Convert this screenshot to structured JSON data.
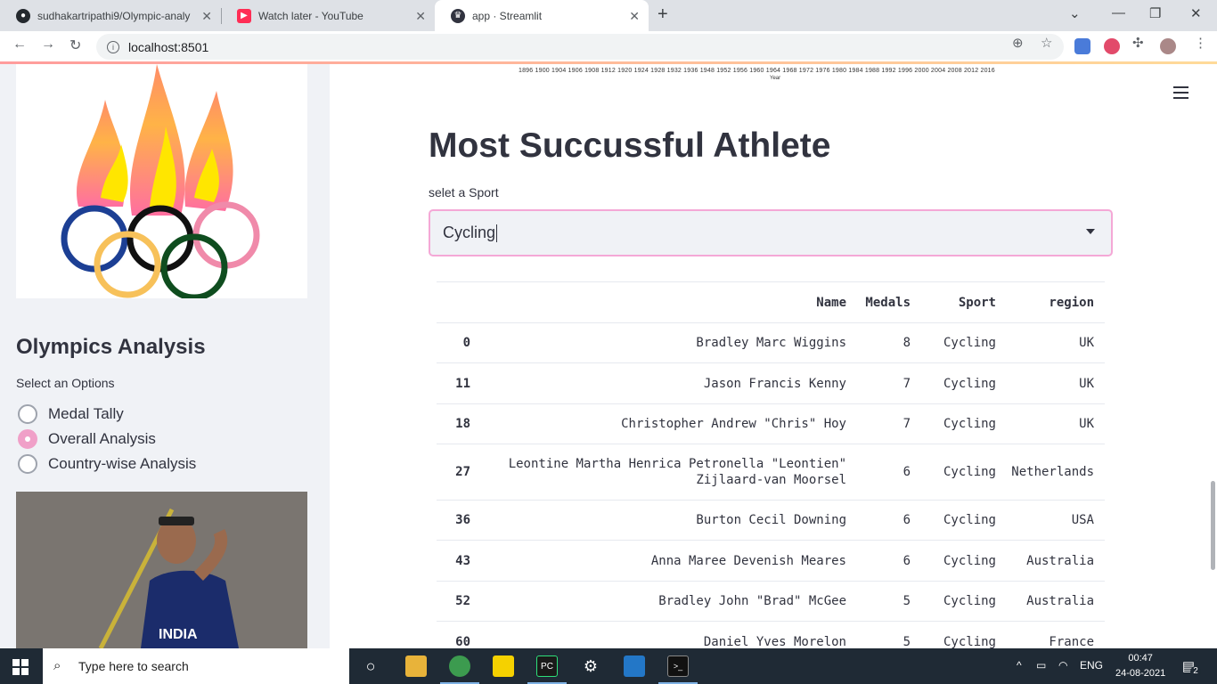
{
  "browser": {
    "tabs": [
      {
        "label": "sudhakartripathi9/Olympic-analy",
        "icon": "github-icon",
        "active": false
      },
      {
        "label": "Watch later - YouTube",
        "icon": "youtube-icon",
        "active": false
      },
      {
        "label": "app · Streamlit",
        "icon": "streamlit-icon",
        "active": true
      }
    ],
    "url": "localhost:8501"
  },
  "sidebar": {
    "title": "Olympics Analysis",
    "options_label": "Select an Options",
    "options": [
      {
        "label": "Medal Tally",
        "selected": false
      },
      {
        "label": "Overall Analysis",
        "selected": true
      },
      {
        "label": "Country-wise Analysis",
        "selected": false
      }
    ],
    "accent_color": "#f0a0c8"
  },
  "main": {
    "prev_chart_axis": {
      "ticks": "1896 1900 1904 1906 1908 1912 1920 1924 1928 1932 1936 1948 1952 1956 1960 1964 1968 1972 1976 1980 1984 1988 1992 1996 2000 2004 2008 2012 2016",
      "xlabel": "Year"
    },
    "heading": "Most Succussful Athlete",
    "select_label": "selet a Sport",
    "select_value": "Cycling",
    "table": {
      "columns": [
        "",
        "Name",
        "Medals",
        "Sport",
        "region"
      ],
      "rows": [
        [
          "0",
          "Bradley Marc Wiggins",
          "8",
          "Cycling",
          "UK"
        ],
        [
          "11",
          "Jason Francis Kenny",
          "7",
          "Cycling",
          "UK"
        ],
        [
          "18",
          "Christopher Andrew \"Chris\" Hoy",
          "7",
          "Cycling",
          "UK"
        ],
        [
          "27",
          "Leontine Martha Henrica Petronella \"Leontien\" Zijlaard-van Moorsel",
          "6",
          "Cycling",
          "Netherlands"
        ],
        [
          "36",
          "Burton Cecil Downing",
          "6",
          "Cycling",
          "USA"
        ],
        [
          "43",
          "Anna Maree Devenish Meares",
          "6",
          "Cycling",
          "Australia"
        ],
        [
          "52",
          "Bradley John \"Brad\" McGee",
          "5",
          "Cycling",
          "Australia"
        ],
        [
          "60",
          "Daniel Yves Morelon",
          "5",
          "Cycling",
          "France"
        ]
      ]
    }
  },
  "taskbar": {
    "search_placeholder": "Type here to search",
    "language": "ENG",
    "time": "00:47",
    "date": "24-08-2021",
    "notifications": "2"
  }
}
